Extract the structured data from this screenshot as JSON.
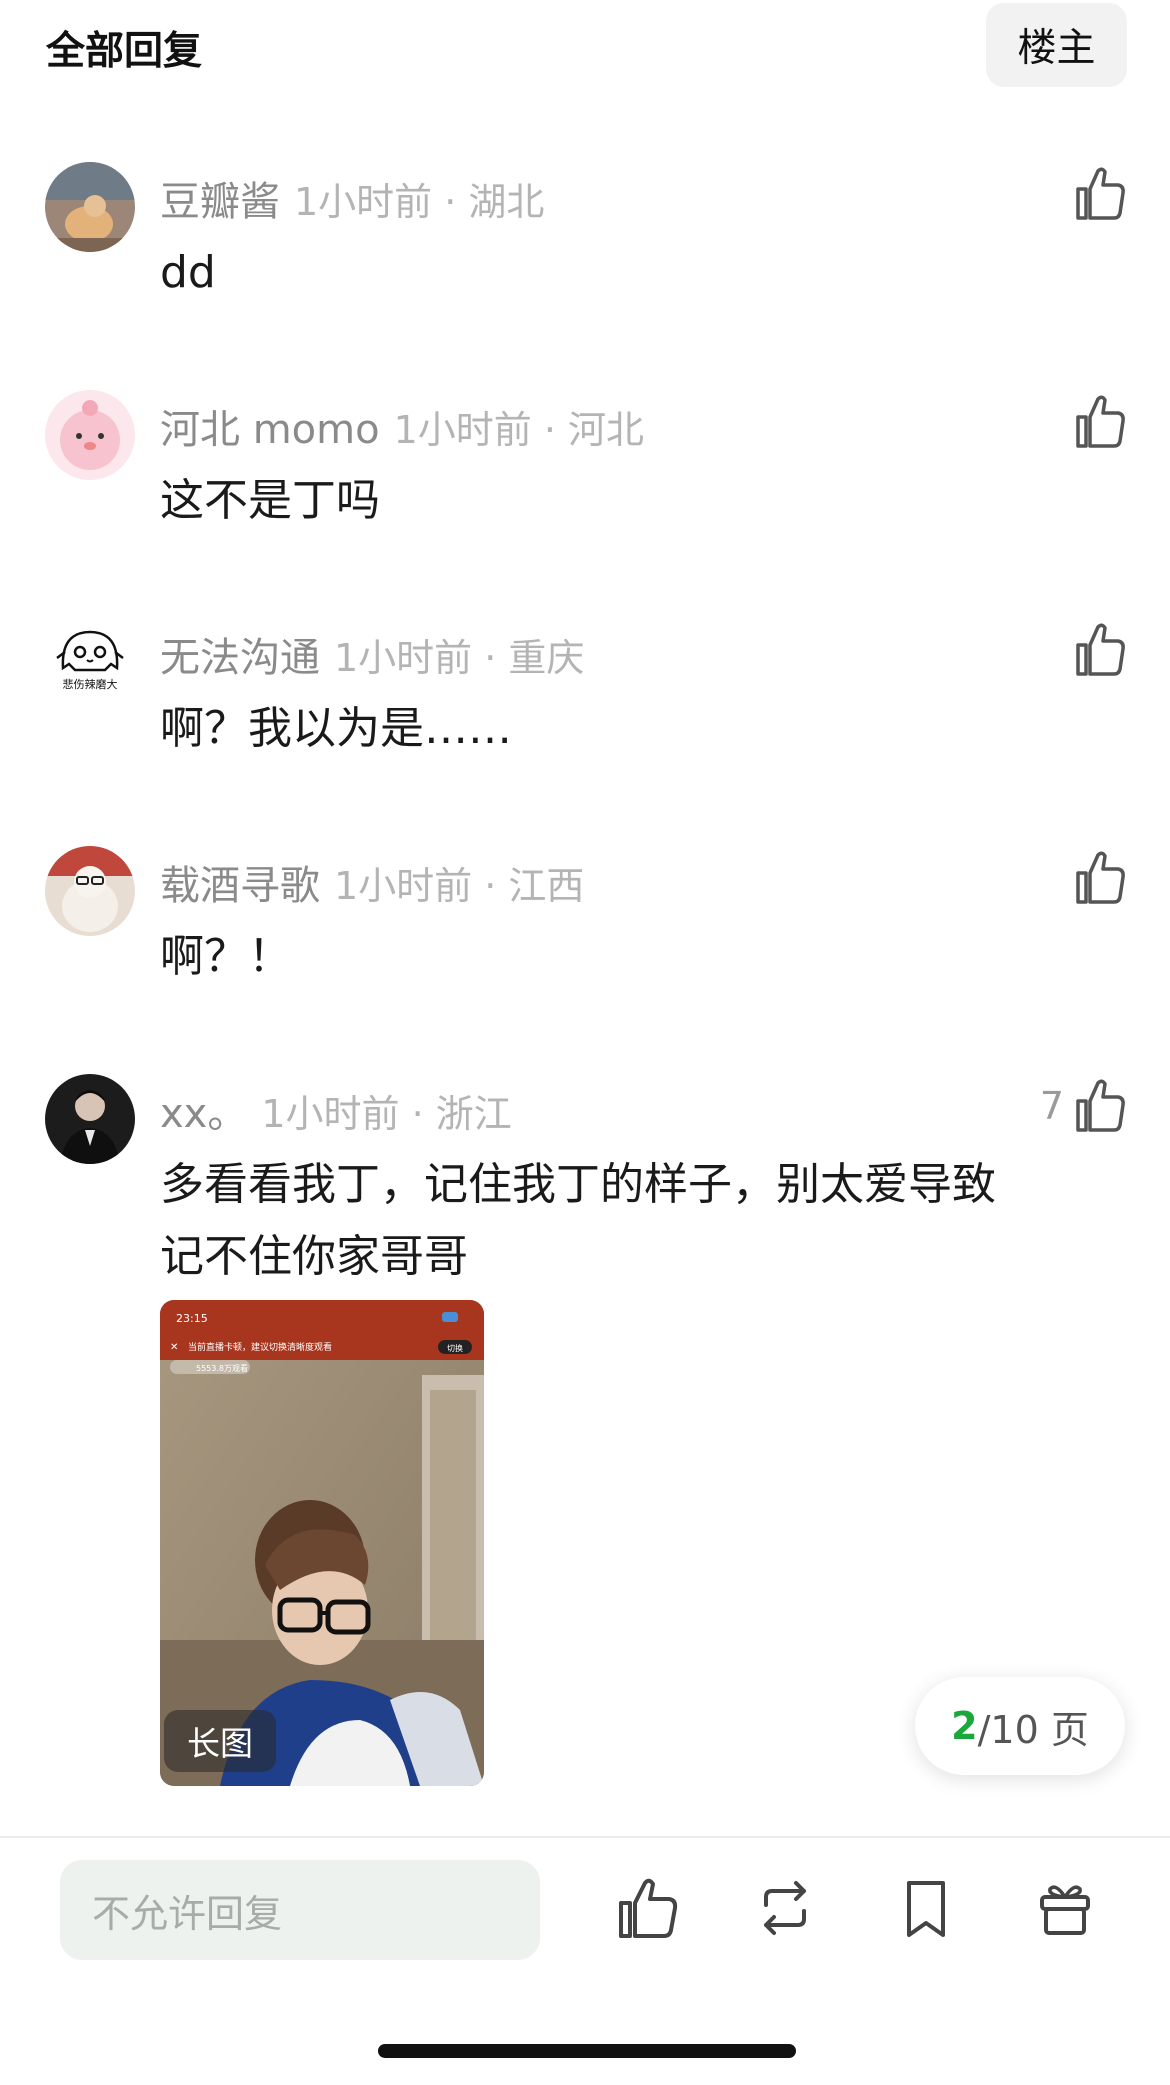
{
  "header": {
    "title": "全部回复",
    "op_label": "楼主"
  },
  "comments": [
    {
      "username": "豆瓣酱",
      "time_location": "1小时前 · 湖北",
      "text": "dd",
      "likes": ""
    },
    {
      "username": "河北 momo",
      "time_location": "1小时前 · 河北",
      "text": "这不是丁吗",
      "likes": ""
    },
    {
      "username": "无法沟通",
      "time_location": "1小时前 · 重庆",
      "text": "啊？我以为是……",
      "likes": "",
      "avatar_text": "悲伤辣磨大"
    },
    {
      "username": "载酒寻歌",
      "time_location": "1小时前 · 江西",
      "text": "啊？！",
      "likes": ""
    },
    {
      "username": "xx。",
      "time_location": "1小时前 · 浙江",
      "text_line1": "多看看我丁，记住我丁的样子，别太爱导致",
      "text_line2": "记不住你家哥哥",
      "likes": "7"
    }
  ],
  "image": {
    "tag": "长图",
    "status_time": "23:15",
    "banner_text": "当前直播卡顿，建议切换清晰度观看",
    "banner_button": "切换",
    "viewer_text": "5553.8万观看"
  },
  "pagination": {
    "current": "2",
    "total_suffix": "/10 页"
  },
  "bottom_bar": {
    "reply_placeholder": "不允许回复",
    "icons": [
      "thumbs-up-icon",
      "repost-icon",
      "bookmark-icon",
      "gift-icon"
    ]
  },
  "colors": {
    "accent_green": "#1aa83a",
    "meta_gray": "#8a8a8a",
    "reply_bg": "#eef2ef"
  }
}
